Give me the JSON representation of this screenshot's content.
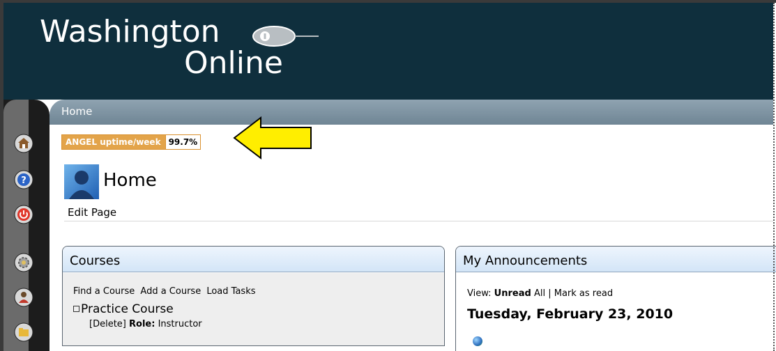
{
  "brand": {
    "line1": "Washington",
    "line2": "Online"
  },
  "nav": {
    "tab_label": "Home",
    "buttons": [
      "home-icon",
      "help-icon",
      "logout-icon",
      "settings-icon",
      "user-icon",
      "folder-icon"
    ]
  },
  "uptime": {
    "label": "ANGEL uptime/week",
    "value": "99.7%"
  },
  "page": {
    "title": "Home",
    "edit_label": "Edit Page"
  },
  "courses": {
    "title": "Courses",
    "links": [
      "Find a Course",
      "Add a Course",
      "Load Tasks"
    ],
    "item_name": "Practice Course",
    "delete_label": "[Delete]",
    "role_label": "Role:",
    "role_value": "Instructor"
  },
  "announcements": {
    "title": "My Announcements",
    "view_label": "View:",
    "view_unread": "Unread",
    "view_all": "All",
    "separator": "|",
    "mark_read": "Mark as read",
    "date": "Tuesday, February 23, 2010"
  },
  "colors": {
    "header_bg": "#0f2f3d",
    "badge_orange": "#e3a44a",
    "arrow_yellow": "#ffee00"
  }
}
